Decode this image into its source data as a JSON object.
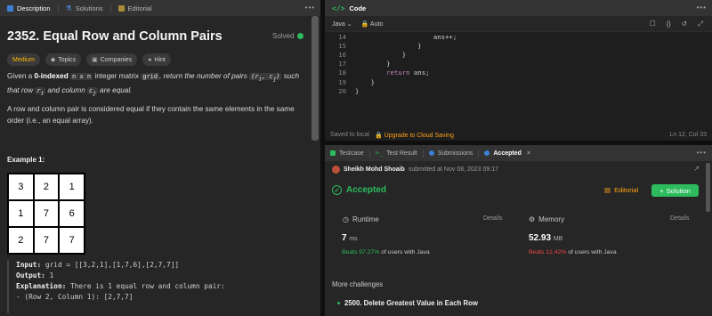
{
  "description_panel": {
    "tabs": [
      "Description",
      "Solutions",
      "Editorial"
    ],
    "title": "2352. Equal Row and Column Pairs",
    "solved_label": "Solved",
    "chips": {
      "difficulty": "Medium",
      "topics": "Topics",
      "companies": "Companies",
      "hint": "Hint"
    },
    "para1": {
      "t1": "Given a ",
      "bold": "0-indexed",
      "code1": "n x n",
      "t2": " integer matrix ",
      "code2": "grid",
      "t3": ", return the number of pairs ",
      "code3": "(r",
      "code3b": "i",
      "code3c": ", c",
      "code3d": "j",
      "code3e": ")",
      "t4": " such that row ",
      "r": "r",
      "ri": "i",
      "t5": " and column ",
      "c": "c",
      "cj": "j",
      "t6": " are equal."
    },
    "para2": "A row and column pair is considered equal if they contain the same elements in the same order (i.e., an equal array).",
    "example_title": "Example 1:",
    "grid": [
      [
        "3",
        "2",
        "1"
      ],
      [
        "1",
        "7",
        "6"
      ],
      [
        "2",
        "7",
        "7"
      ]
    ],
    "example": {
      "input_label": "Input:",
      "input_value": "grid = [[3,2,1],[1,7,6],[2,7,7]]",
      "output_label": "Output:",
      "output_value": "1",
      "explanation_label": "Explanation:",
      "explanation_value": "There is 1 equal row and column pair:",
      "explanation_line2": "- (Row 2, Column 1): [2,7,7]"
    }
  },
  "code_panel": {
    "header": "Code",
    "language": "Java",
    "auto": "Auto",
    "lines": [
      {
        "n": "14",
        "text": "                    ans++;"
      },
      {
        "n": "15",
        "text": "                }"
      },
      {
        "n": "16",
        "text": "            }"
      },
      {
        "n": "17",
        "text": "        }"
      },
      {
        "n": "18",
        "kw": "return",
        "text": " ans;",
        "indent": "        "
      },
      {
        "n": "19",
        "text": "    }"
      },
      {
        "n": "20",
        "text": "}"
      }
    ],
    "saved": "Saved to local",
    "upgrade": "Upgrade to Cloud Saving",
    "cursor": "Ln 12, Col 33"
  },
  "result_panel": {
    "tabs": [
      "Testcase",
      "Test Result",
      "Submissions",
      "Accepted"
    ],
    "user": "Sheikh Mohd Shoaib",
    "submitted": "submitted at Nov 08, 2023 09:17",
    "status": "Accepted",
    "editorial": "Editorial",
    "solution": "Solution",
    "runtime": {
      "label": "Runtime",
      "details": "Details",
      "value": "7",
      "unit": "ms",
      "beats_prefix": "Beats",
      "beats_pct": "97.27%",
      "beats_suffix": "of users with Java"
    },
    "memory": {
      "label": "Memory",
      "details": "Details",
      "value": "52.93",
      "unit": "MB",
      "beats_prefix": "Beats",
      "beats_pct": "12.42%",
      "beats_suffix": "of users with Java"
    },
    "more_challenges": "More challenges",
    "challenge_1": "2500. Delete Greatest Value in Each Row"
  },
  "colors": {
    "accent_green": "#2cbb5d",
    "accent_orange": "#ffa116",
    "medium_yellow": "#ffb800",
    "beats_red": "#ef4743"
  }
}
